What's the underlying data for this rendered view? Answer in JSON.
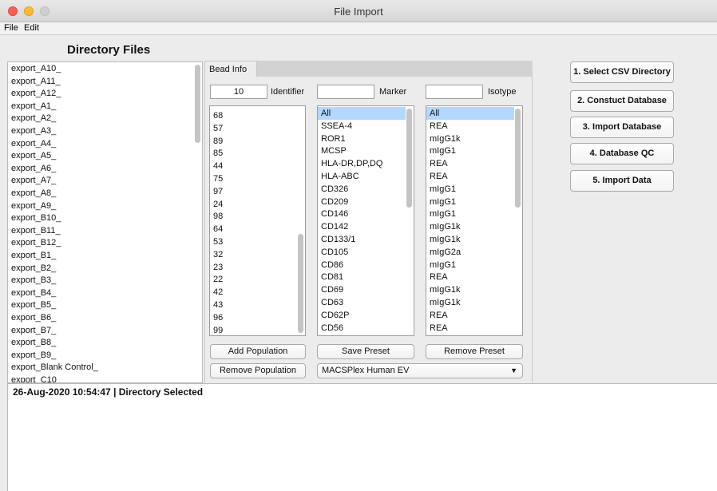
{
  "window": {
    "title": "File Import"
  },
  "menu": {
    "file": "File",
    "edit": "Edit"
  },
  "directory": {
    "header": "Directory Files",
    "files": [
      "export_A10_",
      "export_A11_",
      "export_A12_",
      "export_A1_",
      "export_A2_",
      "export_A3_",
      "export_A4_",
      "export_A5_",
      "export_A6_",
      "export_A7_",
      "export_A8_",
      "export_A9_",
      "export_B10_",
      "export_B11_",
      "export_B12_",
      "export_B1_",
      "export_B2_",
      "export_B3_",
      "export_B4_",
      "export_B5_",
      "export_B6_",
      "export_B7_",
      "export_B8_",
      "export_B9_",
      "export_Blank Control_",
      "export_C10_"
    ]
  },
  "tab": {
    "label": "Bead Info"
  },
  "fields": {
    "identifier_value": "10",
    "identifier_label": "Identifier",
    "marker_value": "",
    "marker_label": "Marker",
    "isotype_value": "",
    "isotype_label": "Isotype"
  },
  "identifiers": [
    "68",
    "57",
    "89",
    "85",
    "44",
    "75",
    "97",
    "24",
    "98",
    "64",
    "53",
    "32",
    "23",
    "22",
    "42",
    "43",
    "96",
    "99"
  ],
  "markers": [
    "All",
    "SSEA-4",
    "ROR1",
    "MCSP",
    "HLA-DR,DP,DQ",
    "HLA-ABC",
    "CD326",
    "CD209",
    "CD146",
    "CD142",
    "CD133/1",
    "CD105",
    "CD86",
    "CD81",
    "CD69",
    "CD63",
    "CD62P",
    "CD56"
  ],
  "isotypes": [
    "All",
    "REA",
    "mIgG1k",
    "mIgG1",
    "REA",
    "REA",
    "mIgG1",
    "mIgG1",
    "mIgG1",
    "mIgG1k",
    "mIgG1k",
    "mIgG2a",
    "mIgG1",
    "REA",
    "mIgG1k",
    "mIgG1k",
    "REA",
    "REA"
  ],
  "buttons": {
    "add_population": "Add Population",
    "save_preset": "Save Preset",
    "remove_preset": "Remove Preset",
    "remove_population": "Remove Population"
  },
  "preset_select": {
    "value": "MACSPlex Human EV"
  },
  "actions": {
    "select_csv": "1. Select CSV Directory",
    "construct_db": "2. Constuct Database",
    "import_db": "3. Import Database",
    "db_qc": "4. Database QC",
    "import_data": "5. Import Data"
  },
  "log": {
    "line": "26-Aug-2020 10:54:47 | Directory Selected"
  },
  "colors": {
    "selection": "#b3d7ff"
  }
}
